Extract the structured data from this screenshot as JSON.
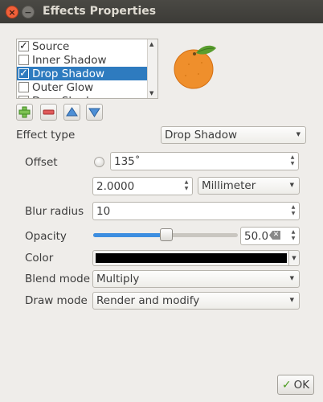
{
  "window": {
    "title": "Effects Properties"
  },
  "effects_list": {
    "items": [
      {
        "label": "Source",
        "checked": true,
        "selected": false
      },
      {
        "label": "Inner Shadow",
        "checked": false,
        "selected": false
      },
      {
        "label": "Drop Shadow",
        "checked": true,
        "selected": true
      },
      {
        "label": "Outer Glow",
        "checked": false,
        "selected": false
      },
      {
        "label": "Drop Shad",
        "checked": false,
        "selected": false
      }
    ]
  },
  "toolbar": {
    "add_icon": "plus-icon",
    "remove_icon": "minus-icon",
    "up_icon": "arrow-up-icon",
    "down_icon": "arrow-down-icon"
  },
  "form": {
    "effect_type_label": "Effect type",
    "effect_type_value": "Drop Shadow",
    "offset_label": "Offset",
    "offset_angle": "135˚",
    "offset_distance": "2.0000",
    "offset_unit": "Millimeter",
    "blur_radius_label": "Blur radius",
    "blur_radius_value": "10",
    "opacity_label": "Opacity",
    "opacity_value": "50.0",
    "opacity_slider_fraction": 0.5,
    "color_label": "Color",
    "color_value_hex": "#000000",
    "blend_mode_label": "Blend mode",
    "blend_mode_value": "Multiply",
    "draw_mode_label": "Draw mode",
    "draw_mode_value": "Render and modify"
  },
  "buttons": {
    "ok_label": "OK"
  },
  "colors": {
    "selection": "#2e7bbf",
    "titlebar": "#3c3b37",
    "close_button": "#f0603a",
    "slider_fill": "#3d8ee0",
    "orange": "#ef8f2c",
    "leaf": "#5a9e2f"
  }
}
